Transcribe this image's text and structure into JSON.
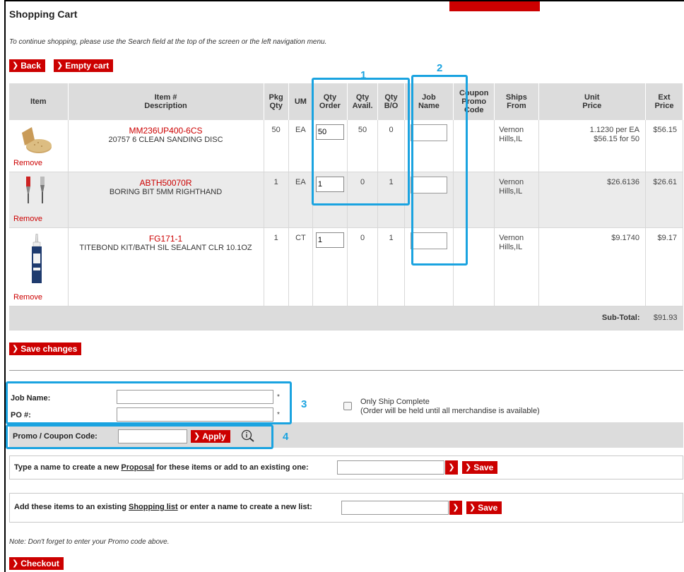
{
  "page": {
    "title": "Shopping Cart",
    "subtitle": "To continue shopping, please use the Search field at the top of the screen or the left navigation menu."
  },
  "toolbar": {
    "back_label": "Back",
    "empty_cart_label": "Empty cart"
  },
  "table": {
    "headers": {
      "item": "Item",
      "item_num_line1": "Item #",
      "item_num_line2": "Description",
      "pkg_line1": "Pkg",
      "pkg_line2": "Qty",
      "um": "UM",
      "qty_order_line1": "Qty",
      "qty_order_line2": "Order",
      "qty_avail_line1": "Qty",
      "qty_avail_line2": "Avail.",
      "qty_bo_line1": "Qty",
      "qty_bo_line2": "B/O",
      "job_line1": "Job",
      "job_line2": "Name",
      "coupon_line1": "Coupon",
      "coupon_line2": "Promo",
      "coupon_line3": "Code",
      "ships_line1": "Ships",
      "ships_line2": "From",
      "unit_line1": "Unit",
      "unit_line2": "Price",
      "ext_line1": "Ext",
      "ext_line2": "Price"
    },
    "rows": [
      {
        "sku": "MM236UP400-6CS",
        "description": "20757 6 CLEAN SANDING DISC",
        "pkg_qty": "50",
        "um": "EA",
        "qty_order": "50",
        "qty_avail": "50",
        "qty_bo": "0",
        "ships_line1": "Vernon",
        "ships_line2": "Hills,IL",
        "unit_price_line1": "1.1230 per EA",
        "unit_price_line2": "$56.15 for 50",
        "ext_price": "$56.15",
        "remove_label": "Remove"
      },
      {
        "sku": "ABTH50070R",
        "description": "BORING BIT 5MM RIGHTHAND",
        "pkg_qty": "1",
        "um": "EA",
        "qty_order": "1",
        "qty_avail": "0",
        "qty_bo": "1",
        "ships_line1": "Vernon",
        "ships_line2": "Hills,IL",
        "unit_price_line1": "$26.6136",
        "unit_price_line2": "",
        "ext_price": "$26.61",
        "remove_label": "Remove"
      },
      {
        "sku": "FG171-1",
        "description": "TITEBOND KIT/BATH SIL SEALANT CLR 10.1OZ",
        "pkg_qty": "1",
        "um": "CT",
        "qty_order": "1",
        "qty_avail": "0",
        "qty_bo": "1",
        "ships_line1": "Vernon",
        "ships_line2": "Hills,IL",
        "unit_price_line1": "$9.1740",
        "unit_price_line2": "",
        "ext_price": "$9.17",
        "remove_label": "Remove"
      }
    ],
    "subtotal_label": "Sub-Total:",
    "subtotal_value": "$91.93"
  },
  "save_changes_label": "Save changes",
  "order_fields": {
    "job_name_label": "Job Name:",
    "po_label": "PO #:",
    "asterisk": "*",
    "only_ship_complete": "Only Ship Complete",
    "only_ship_note": "(Order will be held until all merchandise is available)"
  },
  "promo": {
    "label": "Promo / Coupon Code:",
    "apply_label": "Apply"
  },
  "proposal": {
    "text_before": "Type a name to create a new ",
    "link": "Proposal",
    "text_after": " for these items or add to an existing one:",
    "save_label": "Save"
  },
  "shopping_list": {
    "text_before": "Add these items to an existing ",
    "link": "Shopping list",
    "text_after": " or enter a name to create a new list:",
    "save_label": "Save"
  },
  "note": "Note: Don't forget to enter your Promo code above.",
  "checkout_label": "Checkout",
  "callouts": [
    "1",
    "2",
    "3",
    "4"
  ],
  "colors": {
    "accent_red": "#cc0000",
    "callout_blue": "#1aa3e0",
    "header_gray": "#dcdcdc"
  },
  "icons": {
    "chevron": "chevron-right-icon",
    "info": "magnifier-info-icon",
    "dropdown": "chevron-down-icon"
  }
}
